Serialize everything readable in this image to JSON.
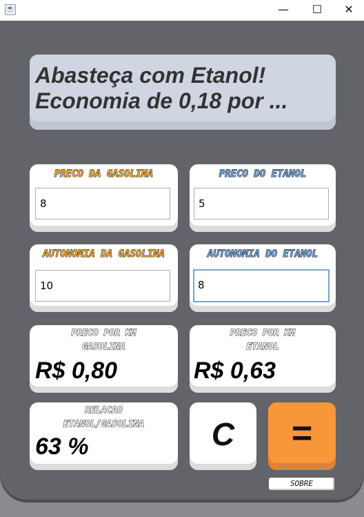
{
  "window": {
    "icon": "java-icon",
    "minimize": "—",
    "maximize": "☐",
    "close": "✕"
  },
  "message": {
    "line1": "Abasteça com Etanol!",
    "line2": "Economia de 0,18 por ..."
  },
  "inputs": {
    "gas_price": {
      "label": "PRECO DA GASOLINA",
      "value": "8"
    },
    "eth_price": {
      "label": "PRECO DO ETANOL",
      "value": "5"
    },
    "gas_autonomy": {
      "label": "AUTONOMIA DA GASOLINA",
      "value": "10"
    },
    "eth_autonomy": {
      "label": "AUTONOMIA DO ETANOL",
      "value": "8"
    }
  },
  "results": {
    "gas_km": {
      "label1": "PRECO POR KM",
      "label2": "GASOLINA",
      "value": "R$ 0,80"
    },
    "eth_km": {
      "label1": "PRECO POR KM",
      "label2": "ETANOL",
      "value": "R$ 0,63"
    },
    "ratio": {
      "label1": "RELACAO",
      "label2": "ETANOL/GASOLINA",
      "value": "63 %"
    }
  },
  "buttons": {
    "clear": "C",
    "calculate": "=",
    "about": "SOBRE"
  },
  "colors": {
    "gasolina": "#f0a830",
    "etanol": "#6fa0d8",
    "calculate": "#f7973a",
    "background": "#636469"
  }
}
